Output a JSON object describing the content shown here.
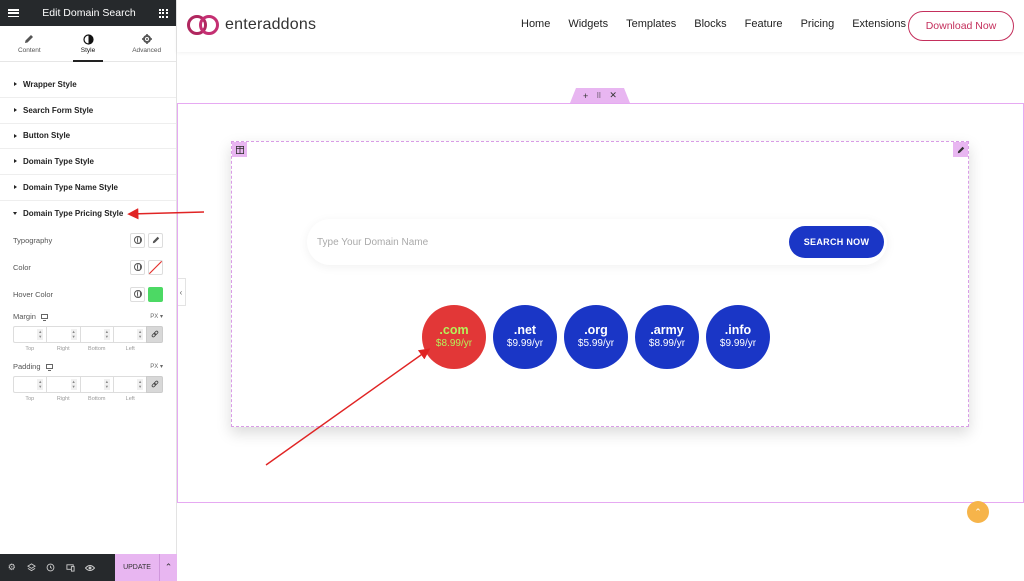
{
  "panel": {
    "header_title": "Edit Domain Search",
    "tabs": [
      {
        "label": "Content",
        "icon": "pencil-icon"
      },
      {
        "label": "Style",
        "icon": "half-circle-icon"
      },
      {
        "label": "Advanced",
        "icon": "gear-icon"
      }
    ],
    "active_tab": "Style",
    "sections": [
      {
        "label": "Wrapper Style"
      },
      {
        "label": "Search Form Style"
      },
      {
        "label": "Button Style"
      },
      {
        "label": "Domain Type Style"
      },
      {
        "label": "Domain Type Name Style"
      },
      {
        "label": "Domain Type Pricing Style"
      }
    ],
    "controls": {
      "typography": "Typography",
      "color": "Color",
      "hover_color": "Hover Color",
      "hover_color_value": "#4cd964",
      "margin": "Margin",
      "padding": "Padding",
      "unit": "PX",
      "dim_labels": [
        "Top",
        "Right",
        "Bottom",
        "Left"
      ]
    },
    "footer": {
      "update_label": "UPDATE"
    }
  },
  "site": {
    "logo_text": "enteraddons",
    "nav": [
      "Home",
      "Widgets",
      "Templates",
      "Blocks",
      "Feature",
      "Pricing",
      "Extensions"
    ],
    "download_label": "Download Now"
  },
  "search": {
    "placeholder": "Type Your Domain Name",
    "value": "",
    "button_label": "SEARCH NOW"
  },
  "domains": [
    {
      "name": ".com",
      "price": "$8.99/yr"
    },
    {
      "name": ".net",
      "price": "$9.99/yr"
    },
    {
      "name": ".org",
      "price": "$5.99/yr"
    },
    {
      "name": ".army",
      "price": "$8.99/yr"
    },
    {
      "name": ".info",
      "price": "$9.99/yr"
    }
  ],
  "colors": {
    "brand": "#c42f5c",
    "button_blue": "#1a36c6",
    "active_domain": "#e23737",
    "price_highlight": "#b6f15a",
    "editor_accent": "#e8b6f1",
    "arrow": "#e02424"
  }
}
